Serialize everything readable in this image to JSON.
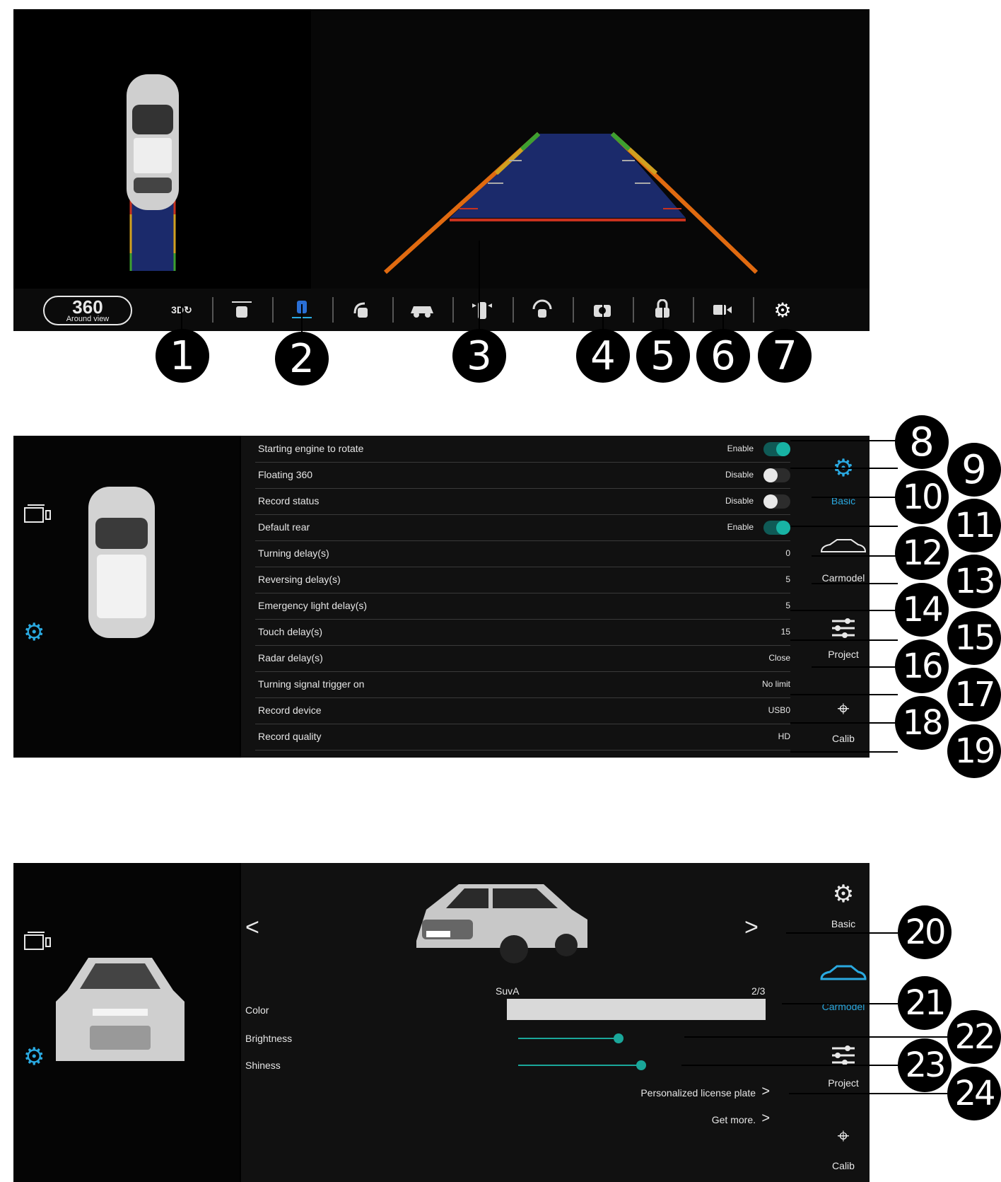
{
  "colors": {
    "accent_blue": "#2aa9e0",
    "toggle_teal": "#18b3a4",
    "slider_teal": "#1aa79a"
  },
  "panel1": {
    "around_view_button": {
      "big": "360",
      "small": "Around view"
    },
    "toolbar_icons": [
      "3d-rotate-icon",
      "front-wide-view-icon",
      "split-view-icon",
      "turn-view-icon",
      "car-side-view-icon",
      "mirror-view-icon",
      "radar-icon",
      "camera-icon",
      "lock-car-icon",
      "video-record-icon",
      "gear-icon"
    ],
    "toolbar_3d_text": "3D",
    "callouts": [
      "1",
      "2",
      "3",
      "4",
      "5",
      "6",
      "7"
    ]
  },
  "panel2": {
    "rows": [
      {
        "label": "Starting engine to rotate",
        "value": "Enable",
        "toggle": "on"
      },
      {
        "label": "Floating 360",
        "value": "Disable",
        "toggle": "off"
      },
      {
        "label": "Record status",
        "value": "Disable",
        "toggle": "off"
      },
      {
        "label": "Default rear",
        "value": "Enable",
        "toggle": "on"
      },
      {
        "label": "Turning delay(s)",
        "value": "0"
      },
      {
        "label": "Reversing delay(s)",
        "value": "5"
      },
      {
        "label": "Emergency light delay(s)",
        "value": "5"
      },
      {
        "label": "Touch delay(s)",
        "value": "15"
      },
      {
        "label": "Radar delay(s)",
        "value": "Close"
      },
      {
        "label": "Turning signal trigger on",
        "value": "No limit"
      },
      {
        "label": "Record device",
        "value": "USB0"
      },
      {
        "label": "Record quality",
        "value": "HD"
      }
    ],
    "side": {
      "basic": "Basic",
      "carmodel": "Carmodel",
      "project": "Project",
      "calib": "Calib"
    },
    "callouts": [
      "8",
      "9",
      "10",
      "11",
      "12",
      "13",
      "14",
      "15",
      "16",
      "17",
      "18",
      "19"
    ]
  },
  "panel3": {
    "model_name": "SuvA",
    "model_page": "2/3",
    "prev": "<",
    "next": ">",
    "color_label": "Color",
    "brightness_label": "Brightness",
    "brightness_value": 0.28,
    "shininess_label": "Shiness",
    "shininess_value": 0.34,
    "license_plate": "Personalized license plate",
    "get_more": "Get more.",
    "side": {
      "basic": "Basic",
      "carmodel": "Carmodel",
      "project": "Project",
      "calib": "Calib"
    },
    "callouts": [
      "20",
      "21",
      "22",
      "23",
      "24"
    ]
  }
}
